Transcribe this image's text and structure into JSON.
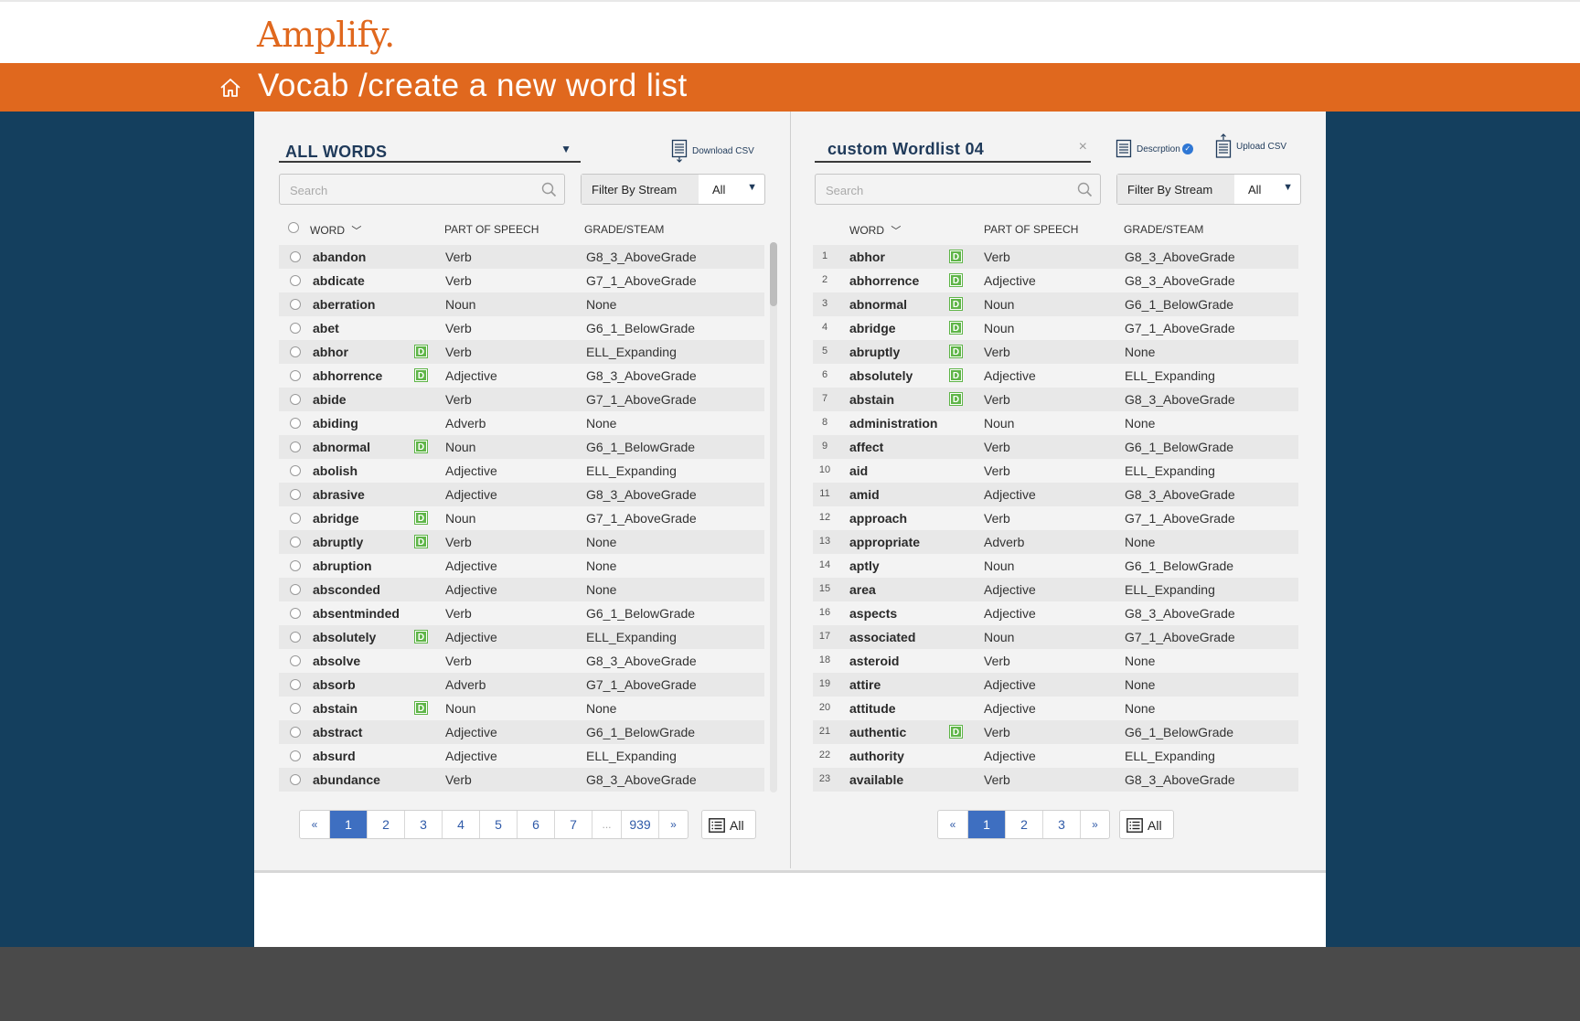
{
  "brand": {
    "logo": "Amplify."
  },
  "header": {
    "title": "Vocab /create a new word list"
  },
  "left": {
    "list_select": "ALL WORDS",
    "download_label": "Download CSV",
    "search_placeholder": "Search",
    "filter_label": "Filter By Stream",
    "filter_value": "All",
    "columns": {
      "word": "WORD",
      "pos": "PART OF SPEECH",
      "grade": "GRADE/STEAM"
    },
    "rows": [
      {
        "word": "abandon",
        "d": false,
        "pos": "Verb",
        "grade": "G8_3_AboveGrade"
      },
      {
        "word": "abdicate",
        "d": false,
        "pos": "Verb",
        "grade": "G7_1_AboveGrade"
      },
      {
        "word": "aberration",
        "d": false,
        "pos": "Noun",
        "grade": "None"
      },
      {
        "word": "abet",
        "d": false,
        "pos": "Verb",
        "grade": "G6_1_BelowGrade"
      },
      {
        "word": "abhor",
        "d": true,
        "pos": "Verb",
        "grade": "ELL_Expanding"
      },
      {
        "word": "abhorrence",
        "d": true,
        "pos": "Adjective",
        "grade": "G8_3_AboveGrade"
      },
      {
        "word": "abide",
        "d": false,
        "pos": "Verb",
        "grade": "G7_1_AboveGrade"
      },
      {
        "word": "abiding",
        "d": false,
        "pos": "Adverb",
        "grade": "None"
      },
      {
        "word": "abnormal",
        "d": true,
        "pos": "Noun",
        "grade": "G6_1_BelowGrade"
      },
      {
        "word": "abolish",
        "d": false,
        "pos": "Adjective",
        "grade": "ELL_Expanding"
      },
      {
        "word": "abrasive",
        "d": false,
        "pos": "Adjective",
        "grade": "G8_3_AboveGrade"
      },
      {
        "word": "abridge",
        "d": true,
        "pos": "Noun",
        "grade": "G7_1_AboveGrade"
      },
      {
        "word": "abruptly",
        "d": true,
        "pos": "Verb",
        "grade": "None"
      },
      {
        "word": "abruption",
        "d": false,
        "pos": "Adjective",
        "grade": "None"
      },
      {
        "word": "absconded",
        "d": false,
        "pos": "Adjective",
        "grade": "None"
      },
      {
        "word": "absentminded",
        "d": false,
        "pos": "Verb",
        "grade": "G6_1_BelowGrade"
      },
      {
        "word": "absolutely",
        "d": true,
        "pos": "Adjective",
        "grade": "ELL_Expanding"
      },
      {
        "word": "absolve",
        "d": false,
        "pos": "Verb",
        "grade": "G8_3_AboveGrade"
      },
      {
        "word": "absorb",
        "d": false,
        "pos": "Adverb",
        "grade": "G7_1_AboveGrade"
      },
      {
        "word": "abstain",
        "d": true,
        "pos": "Noun",
        "grade": "None"
      },
      {
        "word": "abstract",
        "d": false,
        "pos": "Adjective",
        "grade": "G6_1_BelowGrade"
      },
      {
        "word": "absurd",
        "d": false,
        "pos": "Adjective",
        "grade": "ELL_Expanding"
      },
      {
        "word": "abundance",
        "d": false,
        "pos": "Verb",
        "grade": "G8_3_AboveGrade"
      }
    ],
    "pagination": {
      "prev": "«",
      "pages": [
        "1",
        "2",
        "3",
        "4",
        "5",
        "6",
        "7"
      ],
      "ellipsis": "...",
      "last": "939",
      "next": "»",
      "active": "1"
    },
    "all_label": "All"
  },
  "right": {
    "list_name": "custom Wordlist 04",
    "clear": "×",
    "description_label": "Descrption",
    "upload_label": "Upload CSV",
    "search_placeholder": "Search",
    "filter_label": "Filter By Stream",
    "filter_value": "All",
    "columns": {
      "word": "WORD",
      "pos": "PART OF SPEECH",
      "grade": "GRADE/STEAM"
    },
    "rows": [
      {
        "n": "1",
        "word": "abhor",
        "d": true,
        "pos": "Verb",
        "grade": "G8_3_AboveGrade"
      },
      {
        "n": "2",
        "word": "abhorrence",
        "d": true,
        "pos": "Adjective",
        "grade": "G8_3_AboveGrade"
      },
      {
        "n": "3",
        "word": "abnormal",
        "d": true,
        "pos": "Noun",
        "grade": "G6_1_BelowGrade"
      },
      {
        "n": "4",
        "word": "abridge",
        "d": true,
        "pos": "Noun",
        "grade": "G7_1_AboveGrade"
      },
      {
        "n": "5",
        "word": "abruptly",
        "d": true,
        "pos": "Verb",
        "grade": "None"
      },
      {
        "n": "6",
        "word": "absolutely",
        "d": true,
        "pos": "Adjective",
        "grade": "ELL_Expanding"
      },
      {
        "n": "7",
        "word": "abstain",
        "d": true,
        "pos": "Verb",
        "grade": "G8_3_AboveGrade"
      },
      {
        "n": "8",
        "word": "administration",
        "d": false,
        "pos": "Noun",
        "grade": "None"
      },
      {
        "n": "9",
        "word": "affect",
        "d": false,
        "pos": "Verb",
        "grade": "G6_1_BelowGrade"
      },
      {
        "n": "10",
        "word": "aid",
        "d": false,
        "pos": "Verb",
        "grade": "ELL_Expanding"
      },
      {
        "n": "11",
        "word": "amid",
        "d": false,
        "pos": "Adjective",
        "grade": "G8_3_AboveGrade"
      },
      {
        "n": "12",
        "word": "approach",
        "d": false,
        "pos": "Verb",
        "grade": "G7_1_AboveGrade"
      },
      {
        "n": "13",
        "word": "appropriate",
        "d": false,
        "pos": "Adverb",
        "grade": "None"
      },
      {
        "n": "14",
        "word": "aptly",
        "d": false,
        "pos": "Noun",
        "grade": "G6_1_BelowGrade"
      },
      {
        "n": "15",
        "word": "area",
        "d": false,
        "pos": "Adjective",
        "grade": "ELL_Expanding"
      },
      {
        "n": "16",
        "word": "aspects",
        "d": false,
        "pos": "Adjective",
        "grade": "G8_3_AboveGrade"
      },
      {
        "n": "17",
        "word": "associated",
        "d": false,
        "pos": "Noun",
        "grade": "G7_1_AboveGrade"
      },
      {
        "n": "18",
        "word": "asteroid",
        "d": false,
        "pos": "Verb",
        "grade": "None"
      },
      {
        "n": "19",
        "word": "attire",
        "d": false,
        "pos": "Adjective",
        "grade": "None"
      },
      {
        "n": "20",
        "word": "attitude",
        "d": false,
        "pos": "Adjective",
        "grade": "None"
      },
      {
        "n": "21",
        "word": "authentic",
        "d": true,
        "pos": "Verb",
        "grade": "G6_1_BelowGrade"
      },
      {
        "n": "22",
        "word": "authority",
        "d": false,
        "pos": "Adjective",
        "grade": "ELL_Expanding"
      },
      {
        "n": "23",
        "word": "available",
        "d": false,
        "pos": "Verb",
        "grade": "G8_3_AboveGrade"
      }
    ],
    "pagination": {
      "prev": "«",
      "pages": [
        "1",
        "2",
        "3"
      ],
      "next": "»",
      "active": "1"
    },
    "all_label": "All"
  },
  "badge_letter": "D",
  "colors": {
    "brand_orange": "#e0681e",
    "navy": "#143f5e",
    "badge_green": "#5fb548",
    "page_active": "#3e6fc1"
  }
}
